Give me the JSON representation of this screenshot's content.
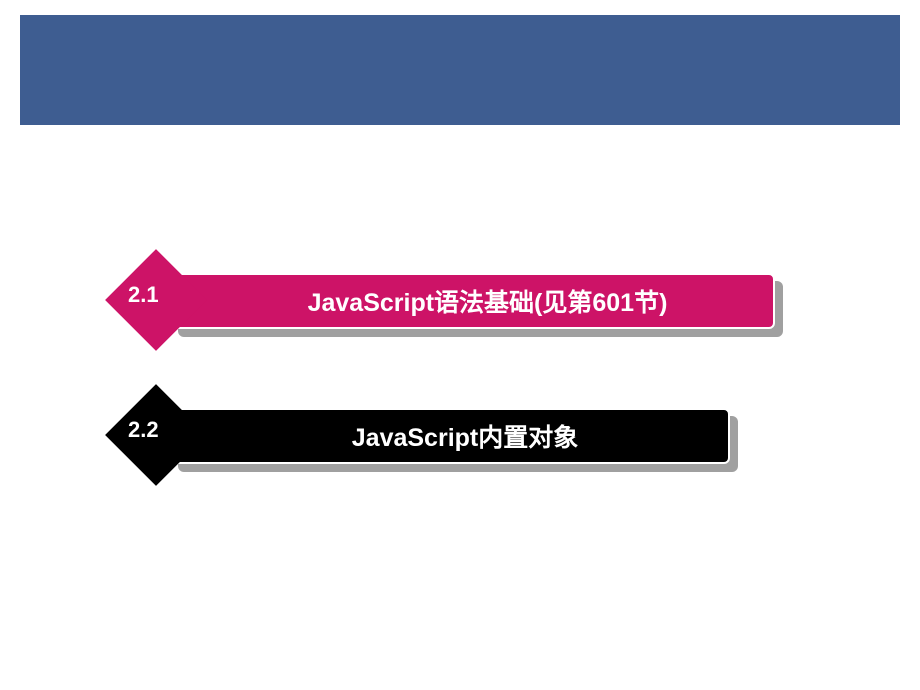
{
  "sections": [
    {
      "number": "2.1",
      "title": "JavaScript语法基础(见第601节)"
    },
    {
      "number": "2.2",
      "title": "JavaScript内置对象"
    }
  ],
  "colors": {
    "banner": "#3e5d91",
    "magenta": "#cd1367",
    "black": "#000000"
  }
}
